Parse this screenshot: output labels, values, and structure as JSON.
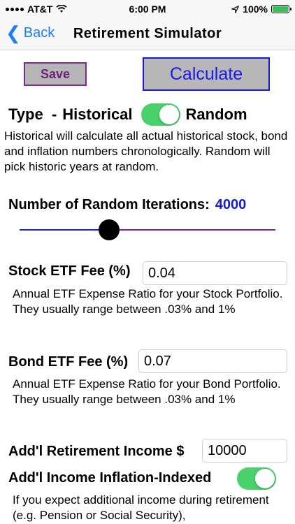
{
  "status_bar": {
    "carrier": "AT&T",
    "time": "6:00 PM",
    "battery": "100%",
    "battery_level": 1.0
  },
  "nav": {
    "back_label": "Back",
    "title": "Retirement Simulator"
  },
  "actions": {
    "save_label": "Save",
    "calculate_label": "Calculate"
  },
  "type": {
    "label": "Type  -",
    "left_option": "Historical",
    "right_option": "Random",
    "toggle_on": true,
    "description": "Historical will calculate all actual historical stock, bond and inflation numbers chronologically.  Random will pick historic years at random."
  },
  "iterations": {
    "label": "Number of Random Iterations:",
    "value": "4000",
    "slider_fraction": 0.35
  },
  "stock_fee": {
    "label": "Stock ETF Fee (%)",
    "value": "0.04",
    "description": "Annual ETF Expense Ratio for your Stock Portfolio.  They usually range between .03% and 1%"
  },
  "bond_fee": {
    "label": "Bond ETF Fee (%)",
    "value": "0.07",
    "description": "Annual ETF Expense Ratio for your Bond Portfolio.  They usually range between .03% and 1%"
  },
  "addl_income": {
    "label": "Add'l Retirement Income $",
    "value": "10000"
  },
  "inflation_indexed": {
    "label": "Add'l Income Inflation-Indexed",
    "toggle_on": true,
    "description": "If you expect additional income during retirement (e.g. Pension or Social Security),"
  },
  "colors": {
    "accent_blue": "#1e7cf6",
    "toggle_green": "#4ad16c",
    "calc_text": "#1a1aeb",
    "save_border": "#7a2a8a"
  }
}
